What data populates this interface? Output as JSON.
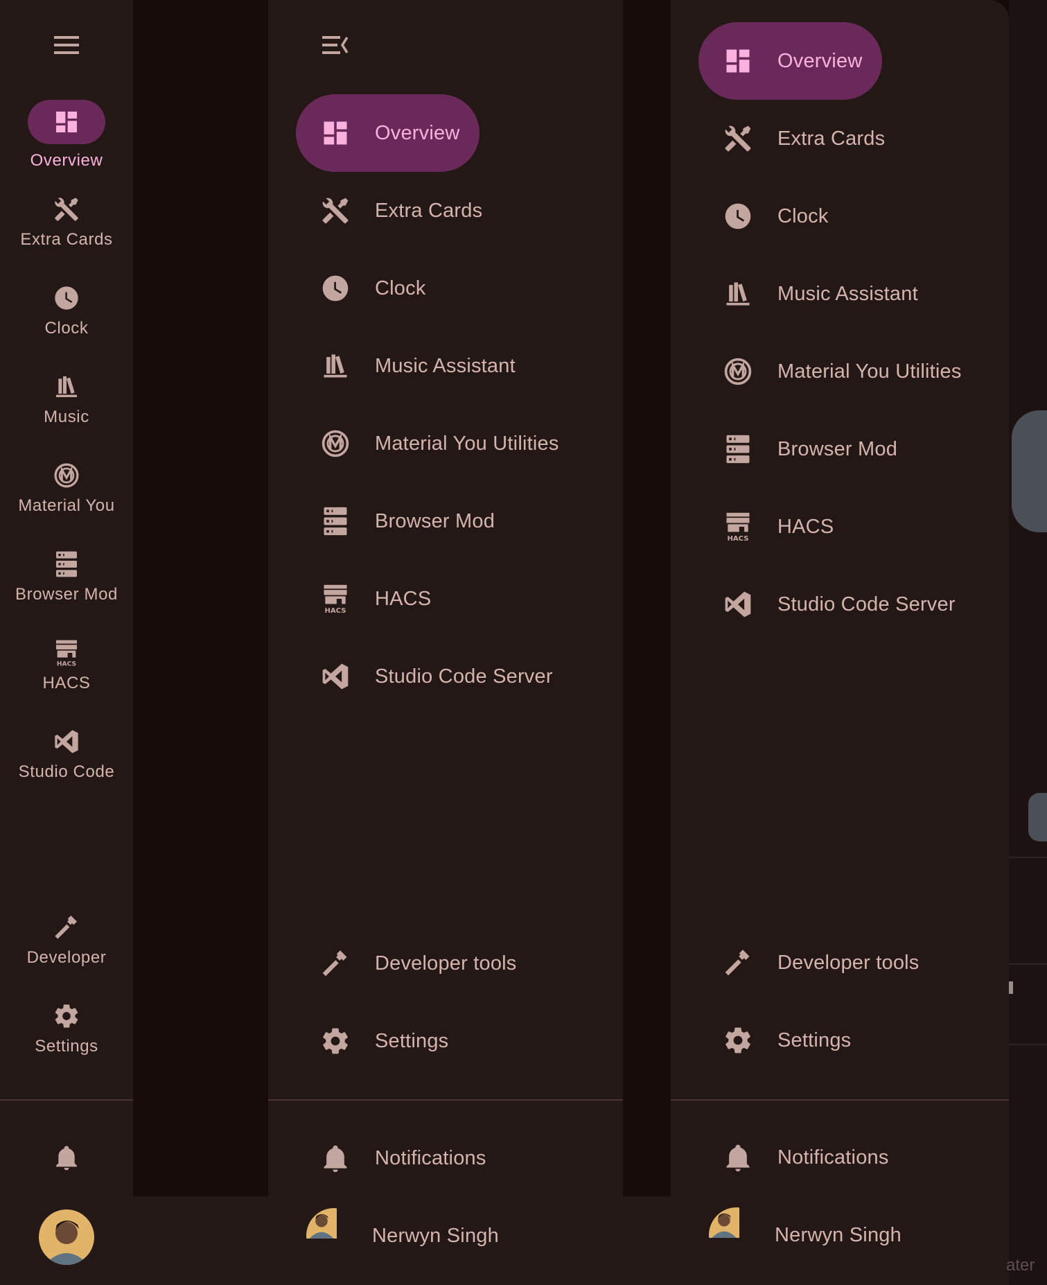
{
  "rail": {
    "items": [
      {
        "label": "Overview",
        "icon": "view-dashboard-icon",
        "active": true
      },
      {
        "label": "Extra Cards",
        "icon": "tools-icon"
      },
      {
        "label": "Clock",
        "icon": "clock-icon"
      },
      {
        "label": "Music",
        "icon": "bookshelf-icon"
      },
      {
        "label": "Material You",
        "icon": "material-you-icon"
      },
      {
        "label": "Browser Mod",
        "icon": "server-icon"
      },
      {
        "label": "HACS",
        "icon": "hacs-icon"
      },
      {
        "label": "Studio Code",
        "icon": "vscode-icon"
      }
    ],
    "developer_label": "Developer",
    "settings_label": "Settings"
  },
  "drawer": {
    "items": [
      {
        "label": "Overview",
        "icon": "view-dashboard-icon",
        "active": true
      },
      {
        "label": "Extra Cards",
        "icon": "tools-icon"
      },
      {
        "label": "Clock",
        "icon": "clock-icon"
      },
      {
        "label": "Music Assistant",
        "icon": "bookshelf-icon"
      },
      {
        "label": "Material You Utilities",
        "icon": "material-you-icon"
      },
      {
        "label": "Browser Mod",
        "icon": "server-icon"
      },
      {
        "label": "HACS",
        "icon": "hacs-icon"
      },
      {
        "label": "Studio Code Server",
        "icon": "vscode-icon"
      }
    ],
    "developer_label": "Developer tools",
    "settings_label": "Settings",
    "notifications_label": "Notifications",
    "user_name": "Nerwyn Singh"
  },
  "background_fragment_text": "ater",
  "colors": {
    "panel": "#231816",
    "accent_pill": "#6a2a59",
    "accent_text": "#fbb1dd",
    "text": "#d6b4ae"
  }
}
